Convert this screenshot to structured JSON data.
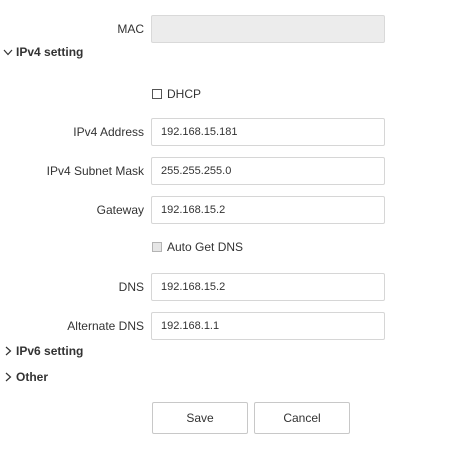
{
  "mac": {
    "label": "MAC",
    "value": ""
  },
  "ipv4_section": {
    "title": "IPv4 setting",
    "expanded": true,
    "dhcp": {
      "label": "DHCP",
      "checked": false
    },
    "address": {
      "label": "IPv4 Address",
      "value": "192.168.15.181"
    },
    "subnet": {
      "label": "IPv4 Subnet Mask",
      "value": "255.255.255.0"
    },
    "gateway": {
      "label": "Gateway",
      "value": "192.168.15.2"
    },
    "auto_dns": {
      "label": "Auto Get DNS",
      "checked": false,
      "disabled": true
    },
    "dns": {
      "label": "DNS",
      "value": "192.168.15.2"
    },
    "alt_dns": {
      "label": "Alternate DNS",
      "value": "192.168.1.1"
    }
  },
  "ipv6_section": {
    "title": "IPv6 setting",
    "expanded": false
  },
  "other_section": {
    "title": "Other",
    "expanded": false
  },
  "buttons": {
    "save": "Save",
    "cancel": "Cancel"
  },
  "icons": {
    "expanded": "chevron-down-icon",
    "collapsed": "chevron-right-icon"
  }
}
